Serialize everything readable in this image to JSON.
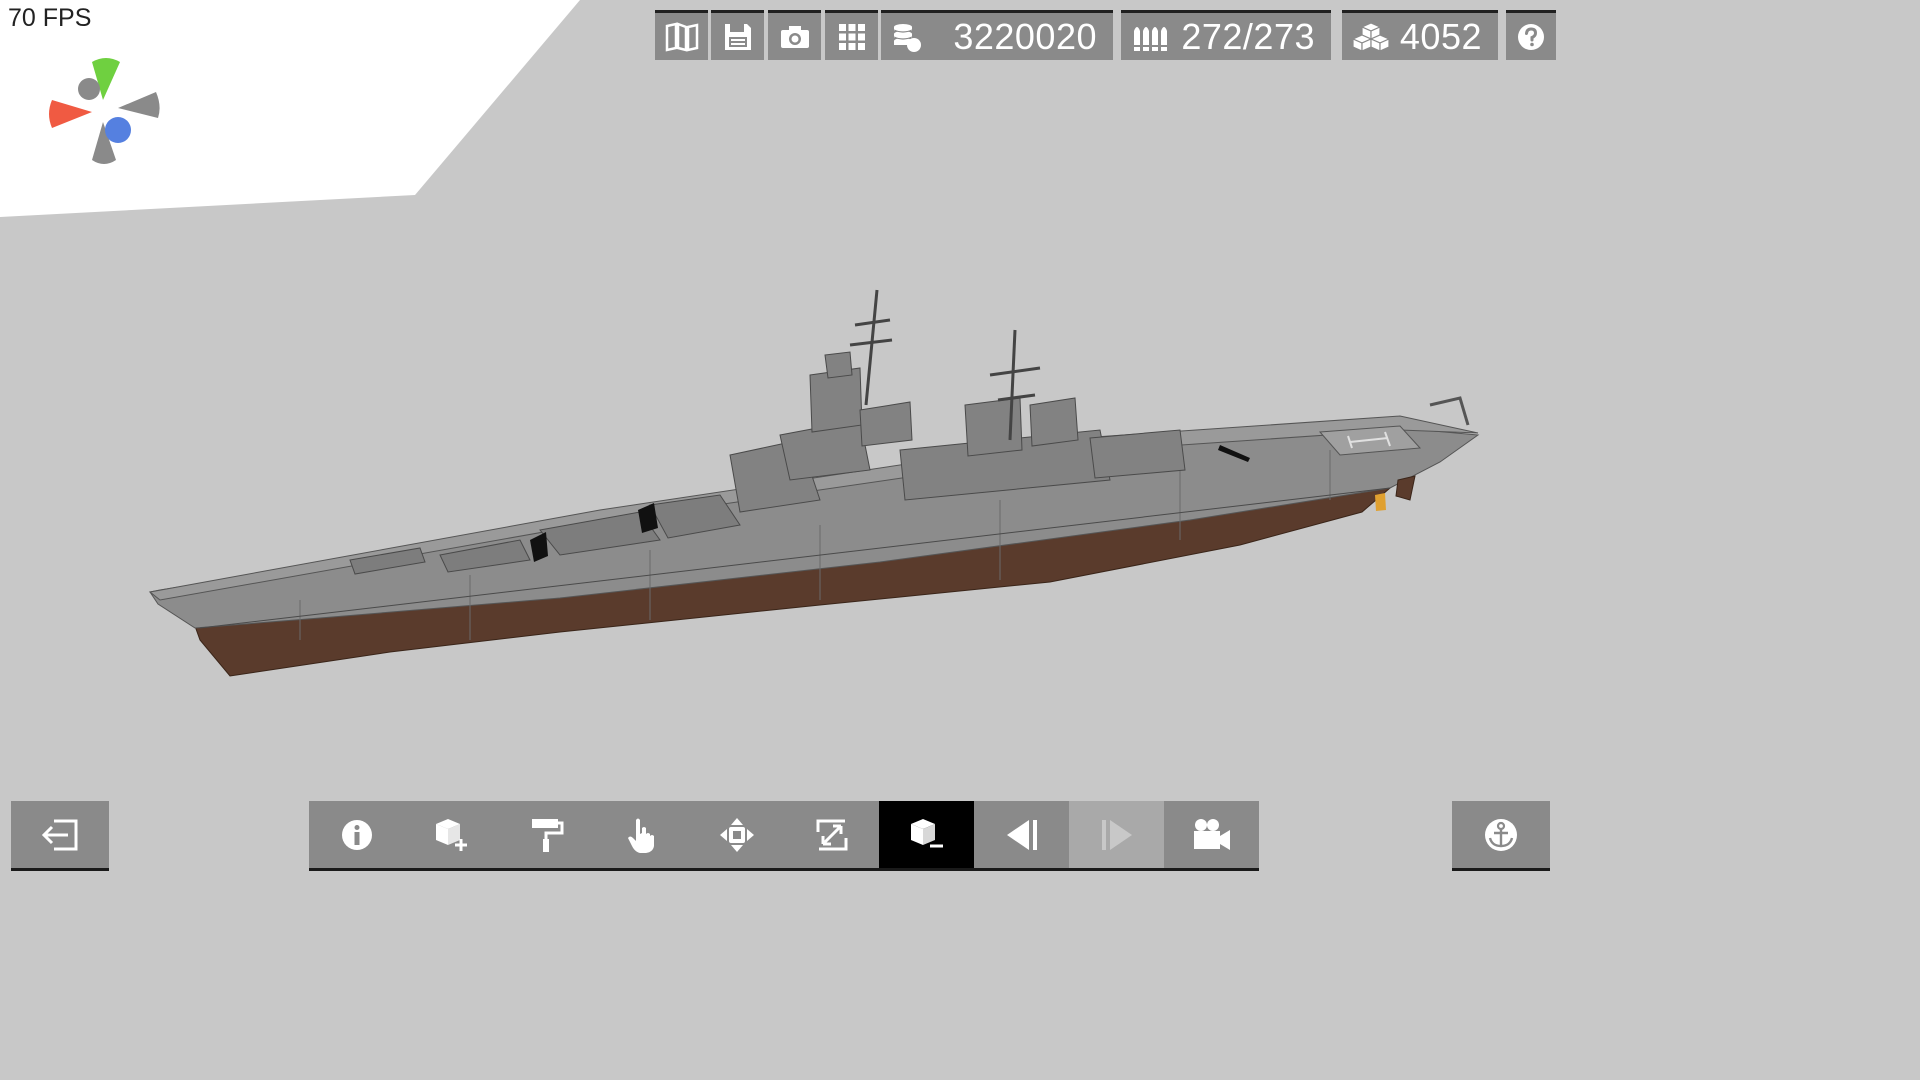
{
  "fps_label": "70 FPS",
  "colors": {
    "background": "#c8c8c8",
    "ground_plane": "#ffffff",
    "toolbar_bg": "#8a8a8a",
    "toolbar_active": "#000000",
    "toolbar_disabled": "#a9a9a9",
    "hull_upper": "#8c8c8c",
    "hull_lower": "#5a3b2c",
    "gizmo_x": "#f05a42",
    "gizmo_y": "#6fd040",
    "gizmo_z": "#5580e0"
  },
  "top_bar": {
    "buttons": [
      {
        "icon": "map-icon"
      },
      {
        "icon": "save-icon"
      },
      {
        "icon": "camera-icon"
      },
      {
        "icon": "grid-icon"
      }
    ],
    "money": {
      "icon": "coins-icon",
      "value": "3220020"
    },
    "ammo": {
      "icon": "ammo-icon",
      "value": "272/273"
    },
    "blocks": {
      "icon": "blocks-icon",
      "value": "4052"
    },
    "help": {
      "icon": "help-icon"
    }
  },
  "bottom_bar": {
    "exit": {
      "icon": "exit-icon"
    },
    "tools": [
      {
        "icon": "info-icon",
        "state": "normal"
      },
      {
        "icon": "add-block-icon",
        "state": "normal"
      },
      {
        "icon": "paint-roller-icon",
        "state": "normal"
      },
      {
        "icon": "hand-pointer-icon",
        "state": "normal"
      },
      {
        "icon": "move-icon",
        "state": "normal"
      },
      {
        "icon": "resize-icon",
        "state": "normal"
      },
      {
        "icon": "remove-block-icon",
        "state": "active"
      },
      {
        "icon": "undo-icon",
        "state": "normal"
      },
      {
        "icon": "redo-icon",
        "state": "disabled"
      },
      {
        "icon": "video-camera-icon",
        "state": "normal"
      }
    ],
    "anchor": {
      "icon": "anchor-icon"
    }
  }
}
